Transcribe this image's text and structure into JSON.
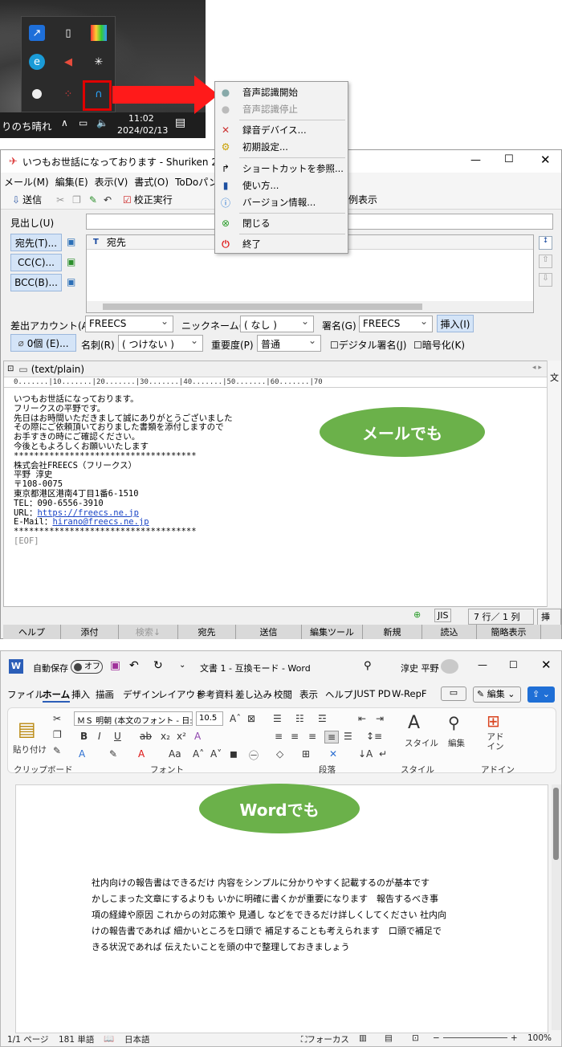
{
  "taskbar": {
    "weather_text": "りのち晴れ",
    "time": "11:02",
    "date": "2024/02/13",
    "tray_icons": [
      "shortcut-icon",
      "usb-icon",
      "color-palette-icon",
      "browser-e-icon",
      "speaker-muted-icon",
      "slack-icon",
      "circle-app-icon",
      "dots-app-icon",
      "headset-mic-icon"
    ],
    "system_icons": [
      "chevron-up-icon",
      "network-icon",
      "volume-icon",
      "notification-icon"
    ]
  },
  "shuriken": {
    "title": "いつもお世話になっております - Shuriken 2016 - [メ",
    "menu": [
      "メール(M)",
      "編集(E)",
      "表示(V)",
      "書式(O)",
      "ToDoパンク("
    ],
    "toolbar": {
      "send": "送信",
      "check": "校正実行",
      "example": "例表示"
    },
    "subject_label": "見出し(U)",
    "to_button": "宛先(T)...",
    "cc_button": "CC(C)...",
    "bcc_button": "BCC(B)...",
    "recipient_header": "宛先",
    "account_label": "差出アカウント(A)",
    "account_value": "FREECS",
    "nickname_label": "ニックネーム(N)",
    "nickname_value": "( なし )",
    "signature_label": "署名(G)",
    "signature_value": "FREECS",
    "insert_button": "挿入(I)",
    "attach_button": "0個 (E)...",
    "title_label": "名刺(R)",
    "title_value": "( つけない )",
    "priority_label": "重要度(P)",
    "priority_value": "普通",
    "digital_sign": "デジタル署名(J)",
    "encrypt": "暗号化(K)",
    "body_tab": "(text/plain)",
    "ruler": "0.......|10.......|20.......|30.......|40.......|50.......|60.......|70",
    "body_lines": [
      "いつもお世話になっております。",
      "フリークスの平野です。",
      "先日はお時間いただきまして誠にありがとうございました",
      "その際にご依頼頂いておりました書類を添付しますので",
      "お手すきの時にご確認ください。",
      "今後ともよろしくお願いいたします",
      "",
      "",
      "************************************",
      "株式会社FREECS（フリークス）",
      "平野 淳史",
      "",
      "〒108-0075",
      "東京都港区港南4丁目1番6-1510",
      "",
      "TEL：090-6556-3910",
      "URL：",
      "E-Mail：",
      "************************************",
      "[EOF]"
    ],
    "url_link": "https://freecs.ne.jp",
    "mail_link": "hirano@freecs.ne.jp",
    "status": {
      "encoding": "JIS",
      "position": "7 行／ 1 列",
      "insert": "挿入"
    },
    "bottom_buttons": [
      "ヘルプ",
      "添付",
      "検索↓",
      "宛先",
      "送信",
      "編集ツール",
      "新規",
      "読込",
      "簡略表示"
    ]
  },
  "context_menu": {
    "items": [
      {
        "label": "音声認識開始",
        "icon": "microphone-icon",
        "enabled": true
      },
      {
        "label": "音声認識停止",
        "icon": "stop-icon",
        "enabled": false
      },
      {
        "label": "録音デバイス...",
        "icon": "tools-icon",
        "enabled": true
      },
      {
        "label": "初期設定...",
        "icon": "gear-icon",
        "enabled": true
      },
      {
        "label": "ショートカットを参照...",
        "icon": "share-arrow-icon",
        "enabled": true
      },
      {
        "label": "使い方...",
        "icon": "help-book-icon",
        "enabled": true
      },
      {
        "label": "バージョン情報...",
        "icon": "info-icon",
        "enabled": true
      },
      {
        "label": "閉じる",
        "icon": "close-circle-icon",
        "enabled": true
      },
      {
        "label": "終了",
        "icon": "power-icon",
        "enabled": true
      }
    ]
  },
  "callouts": {
    "mail": "メールでも",
    "word": "Wordでも"
  },
  "word": {
    "autosave_label": "自動保存",
    "autosave_state": "オフ",
    "doc_title": "文書 1 - 互換モード - Word",
    "user": "淳史 平野",
    "tabs": [
      "ファイル",
      "ホーム",
      "挿入",
      "描画",
      "デザイン",
      "レイアウト",
      "参考資料",
      "差し込み",
      "校閲",
      "表示",
      "ヘルプ",
      "JUST PD",
      "W-RepF"
    ],
    "edit_button": "編集",
    "paste_label": "貼り付け",
    "font_name": "ＭＳ 明朝 (本文のフォント - 日:",
    "font_size": "10.5",
    "style_label": "スタイル",
    "editing_label": "編集",
    "addin_label": "アド イン",
    "groups": [
      "クリップボード",
      "フォント",
      "段落",
      "スタイル",
      "アドイン"
    ],
    "doc_lines": [
      "社内向けの報告書はできるだけ 内容をシンプルに分かりやすく記載するのが基本です",
      "かしこまった文章にするよりも いかに明確に書くかが重要になります　報告するべき事",
      "項の経緯や原因 これからの対応策や 見通し などをできるだけ詳しくしてください 社内向",
      "けの報告書であれば 細かいところを口頭で 補足することも考えられます　口頭で補足で",
      "きる状況であれば 伝えたいことを頭の中で整理しておきましょう"
    ],
    "status": {
      "page": "1/1 ページ",
      "words": "181 単語",
      "lang": "日本語",
      "focus": "フォーカス",
      "zoom": "100%"
    }
  }
}
